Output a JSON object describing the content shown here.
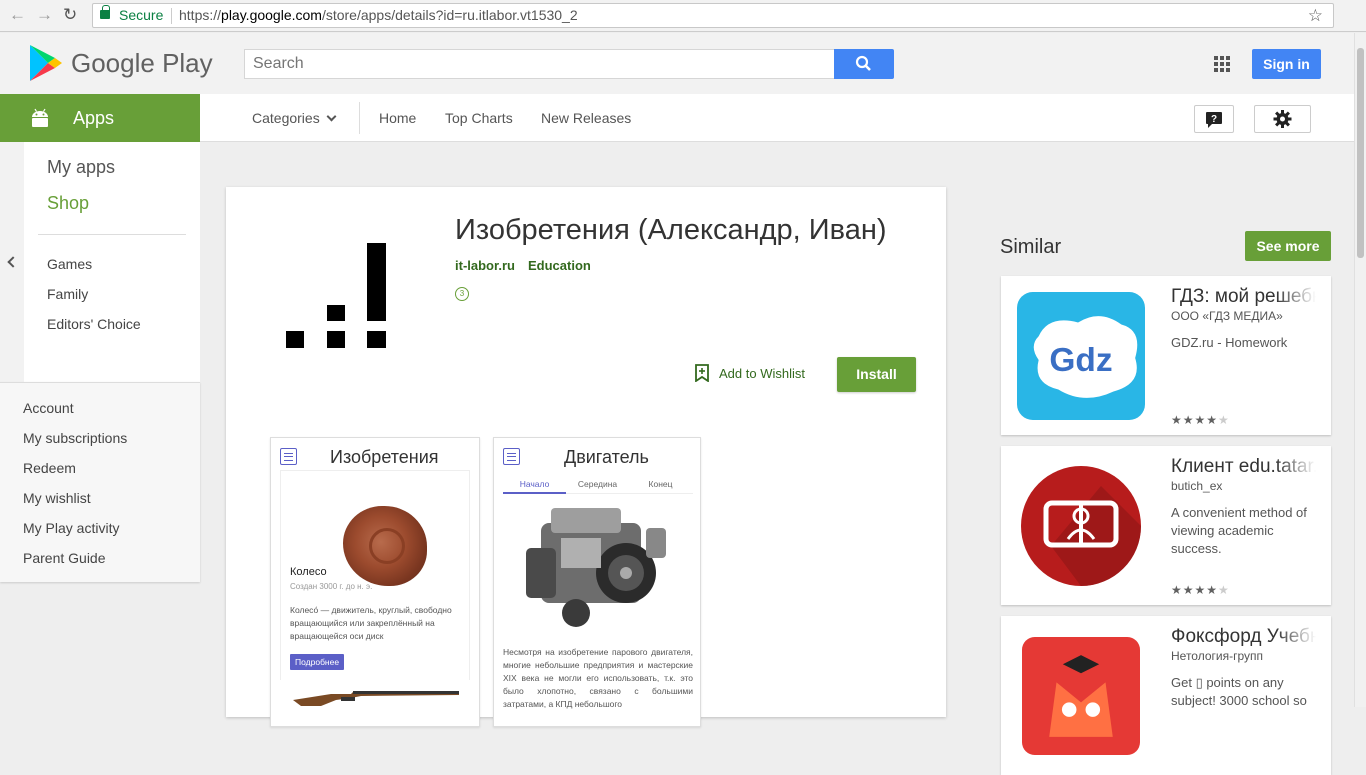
{
  "browser": {
    "security_label": "Secure",
    "url_scheme": "https://",
    "url_host": "play.google.com",
    "url_path": "/store/apps/details?id=ru.itlabor.vt1530_2"
  },
  "header": {
    "brand": "Google Play",
    "search_placeholder": "Search",
    "signin_label": "Sign in"
  },
  "apps_band": {
    "label": "Apps"
  },
  "subnav": {
    "categories": "Categories",
    "home": "Home",
    "top_charts": "Top Charts",
    "new_releases": "New Releases"
  },
  "sidebar": {
    "my_apps": "My apps",
    "shop": "Shop",
    "games": "Games",
    "family": "Family",
    "editors_choice": "Editors' Choice",
    "account": "Account",
    "my_subscriptions": "My subscriptions",
    "redeem": "Redeem",
    "my_wishlist": "My wishlist",
    "my_play_activity": "My Play activity",
    "parent_guide": "Parent Guide"
  },
  "app": {
    "title": "Изобретения (Александр, Иван)",
    "developer": "it-labor.ru",
    "category": "Education",
    "age_badge": "3",
    "wishlist_label": "Add to Wishlist",
    "install_label": "Install"
  },
  "screenshots": [
    {
      "title": "Изобретения",
      "item_name": "Колесо",
      "item_date": "Создан 3000 г. до н. э.",
      "item_desc": "Колесо́ — движитель, круглый, свободно вращающийся или закреплённый на вращающейся оси диск",
      "more_button": "Подробнее"
    },
    {
      "title": "Двигатель",
      "tabs": [
        "Начало",
        "Середина",
        "Конец"
      ],
      "body": "Несмотря на изобретение парового двигателя, многие небольшие предприятия и мастерские XIX века не могли его использовать, т.к. это было хлопотно, связано с большими затратами, а КПД небольшого"
    }
  ],
  "similar": {
    "title": "Similar",
    "see_more": "See more",
    "items": [
      {
        "title": "ГДЗ: мой решебник",
        "publisher": "ООО «ГДЗ МЕДИА»",
        "desc": "GDZ.ru - Homework",
        "rating": 4,
        "icon": "gdz-icon",
        "icon_text": "Gdz"
      },
      {
        "title": "Клиент edu.tatar.ru",
        "publisher": "butich_ex",
        "desc": "A convenient method of viewing academic success.",
        "rating": 4.5,
        "icon": "edu-tatar-icon"
      },
      {
        "title": "Фоксфорд Учебник",
        "publisher": "Нетология-групп",
        "desc": "Get ▯ points on any subject! 3000 school so",
        "icon": "foxford-icon"
      }
    ]
  },
  "colors": {
    "green": "#689f38",
    "dark_green": "#33691e",
    "blue": "#4285f4"
  }
}
